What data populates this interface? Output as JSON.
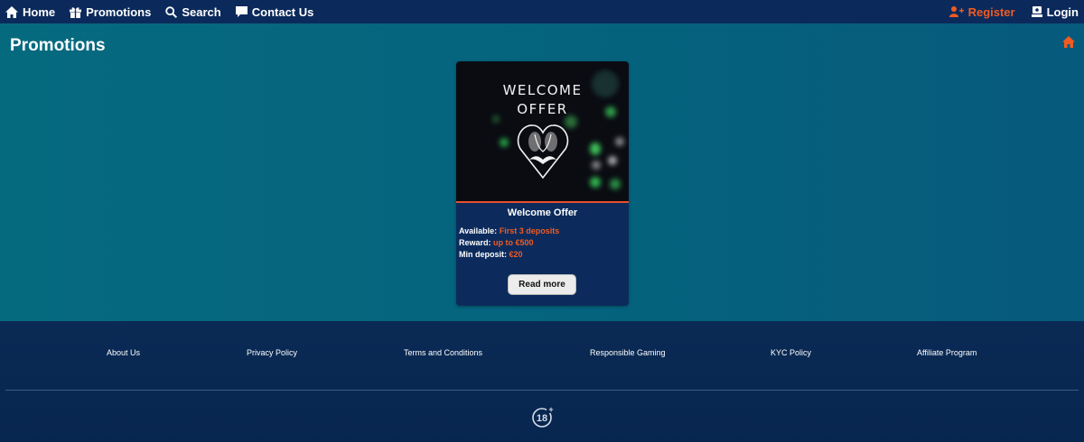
{
  "nav": {
    "home": "Home",
    "promotions": "Promotions",
    "search": "Search",
    "contact": "Contact Us",
    "register": "Register",
    "login": "Login"
  },
  "page": {
    "title": "Promotions"
  },
  "promo": {
    "image_line1": "WELCOME",
    "image_line2": "OFFER",
    "title": "Welcome Offer",
    "available_label": "Available:",
    "available_value": "First 3 deposits",
    "reward_label": "Reward:",
    "reward_value": "up to €500",
    "min_deposit_label": "Min deposit:",
    "min_deposit_value": "€20",
    "button": "Read more"
  },
  "footer": {
    "links": [
      "About Us",
      "Privacy Policy",
      "Terms and Conditions",
      "Responsible Gaming",
      "KYC Policy",
      "Affiliate Program"
    ],
    "age_badge": "18+"
  },
  "colors": {
    "accent": "#f15a22",
    "nav_bg": "#0b2a5b",
    "content_bg": "#06607a",
    "card_bg": "#0c2b5c"
  }
}
